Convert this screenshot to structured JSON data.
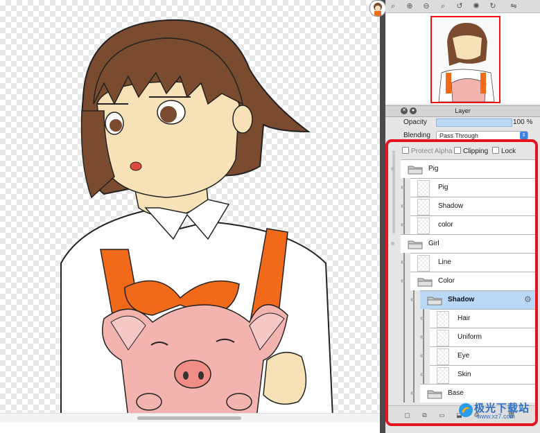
{
  "panel": {
    "layer_title": "Layer",
    "opacity_label": "Opacity",
    "opacity_value": "100 %",
    "opacity_fraction": 1.0,
    "blending_label": "Blending",
    "blending_value": "Pass Through",
    "protect_alpha": "Protect Alpha",
    "clipping": "Clipping",
    "lock": "Lock"
  },
  "layers": [
    {
      "name": "Pig",
      "kind": "folder",
      "depth": 0
    },
    {
      "name": "Pig",
      "kind": "layer",
      "depth": 1
    },
    {
      "name": "Shadow",
      "kind": "layer",
      "depth": 1
    },
    {
      "name": "color",
      "kind": "layer",
      "depth": 1
    },
    {
      "name": "Girl",
      "kind": "folder",
      "depth": 0
    },
    {
      "name": "Line",
      "kind": "layer",
      "depth": 1
    },
    {
      "name": "Color",
      "kind": "folder",
      "depth": 1
    },
    {
      "name": "Shadow",
      "kind": "folder",
      "depth": 2,
      "selected": true
    },
    {
      "name": "Hair",
      "kind": "layer",
      "depth": 3
    },
    {
      "name": "Uniform",
      "kind": "layer",
      "depth": 3
    },
    {
      "name": "Eye",
      "kind": "layer",
      "depth": 3
    },
    {
      "name": "Skin",
      "kind": "layer",
      "depth": 3
    },
    {
      "name": "Base",
      "kind": "folder",
      "depth": 2
    }
  ],
  "watermark": {
    "text": "极光下载站",
    "url": "www.xz7.com"
  },
  "colors": {
    "highlight": "#e4131d",
    "hair": "#7a4b2f",
    "skin": "#f7e2b7",
    "apron": "#f06a1a",
    "pig": "#f3b4b0"
  }
}
